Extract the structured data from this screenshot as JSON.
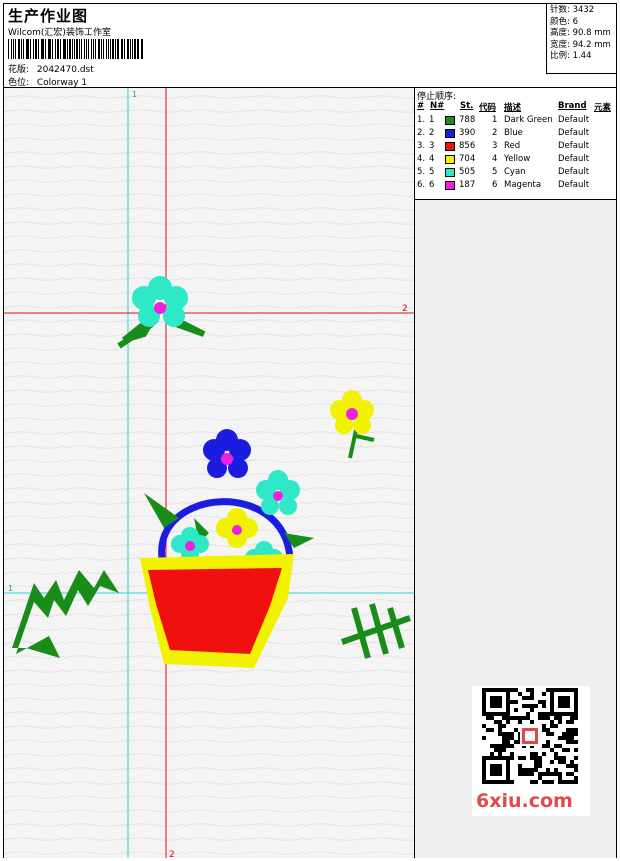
{
  "header": {
    "title": "生产作业图",
    "company": "Wilcom(汇宏)装饰工作室",
    "pattern_label": "花版:",
    "pattern_value": "2042470.dst",
    "colorway_label": "色位:",
    "colorway_value": "Colorway 1"
  },
  "stats": {
    "stitches": "针数: 3432",
    "colors": "颜色: 6",
    "height": "高度: 90.8 mm",
    "width": "宽度: 94.2 mm",
    "scale": "比例: 1.44"
  },
  "stop_sequence": {
    "title": "停止顺序:",
    "columns": [
      "#",
      "N#",
      "St.",
      "代码",
      "描述",
      "Brand",
      "元素"
    ],
    "rows": [
      {
        "idx": "1.",
        "n": "1",
        "st": "788",
        "code": "1",
        "desc": "Dark Green",
        "brand": "Default",
        "color": "#1a8c1a"
      },
      {
        "idx": "2.",
        "n": "2",
        "st": "390",
        "code": "2",
        "desc": "Blue",
        "brand": "Default",
        "color": "#1c1ce0"
      },
      {
        "idx": "3.",
        "n": "3",
        "st": "856",
        "code": "3",
        "desc": "Red",
        "brand": "Default",
        "color": "#f01010"
      },
      {
        "idx": "4.",
        "n": "4",
        "st": "704",
        "code": "4",
        "desc": "Yellow",
        "brand": "Default",
        "color": "#f2f200"
      },
      {
        "idx": "5.",
        "n": "5",
        "st": "505",
        "code": "5",
        "desc": "Cyan",
        "brand": "Default",
        "color": "#2ee8c8"
      },
      {
        "idx": "6.",
        "n": "6",
        "st": "187",
        "code": "6",
        "desc": "Magenta",
        "brand": "Default",
        "color": "#f020e0"
      }
    ]
  },
  "guides": {
    "h1_label": "1",
    "h2_label": "2",
    "v1_label": "1",
    "v2_label": "2"
  },
  "watermark": {
    "text": "6xiu.com",
    "color": "#e04a4a"
  }
}
